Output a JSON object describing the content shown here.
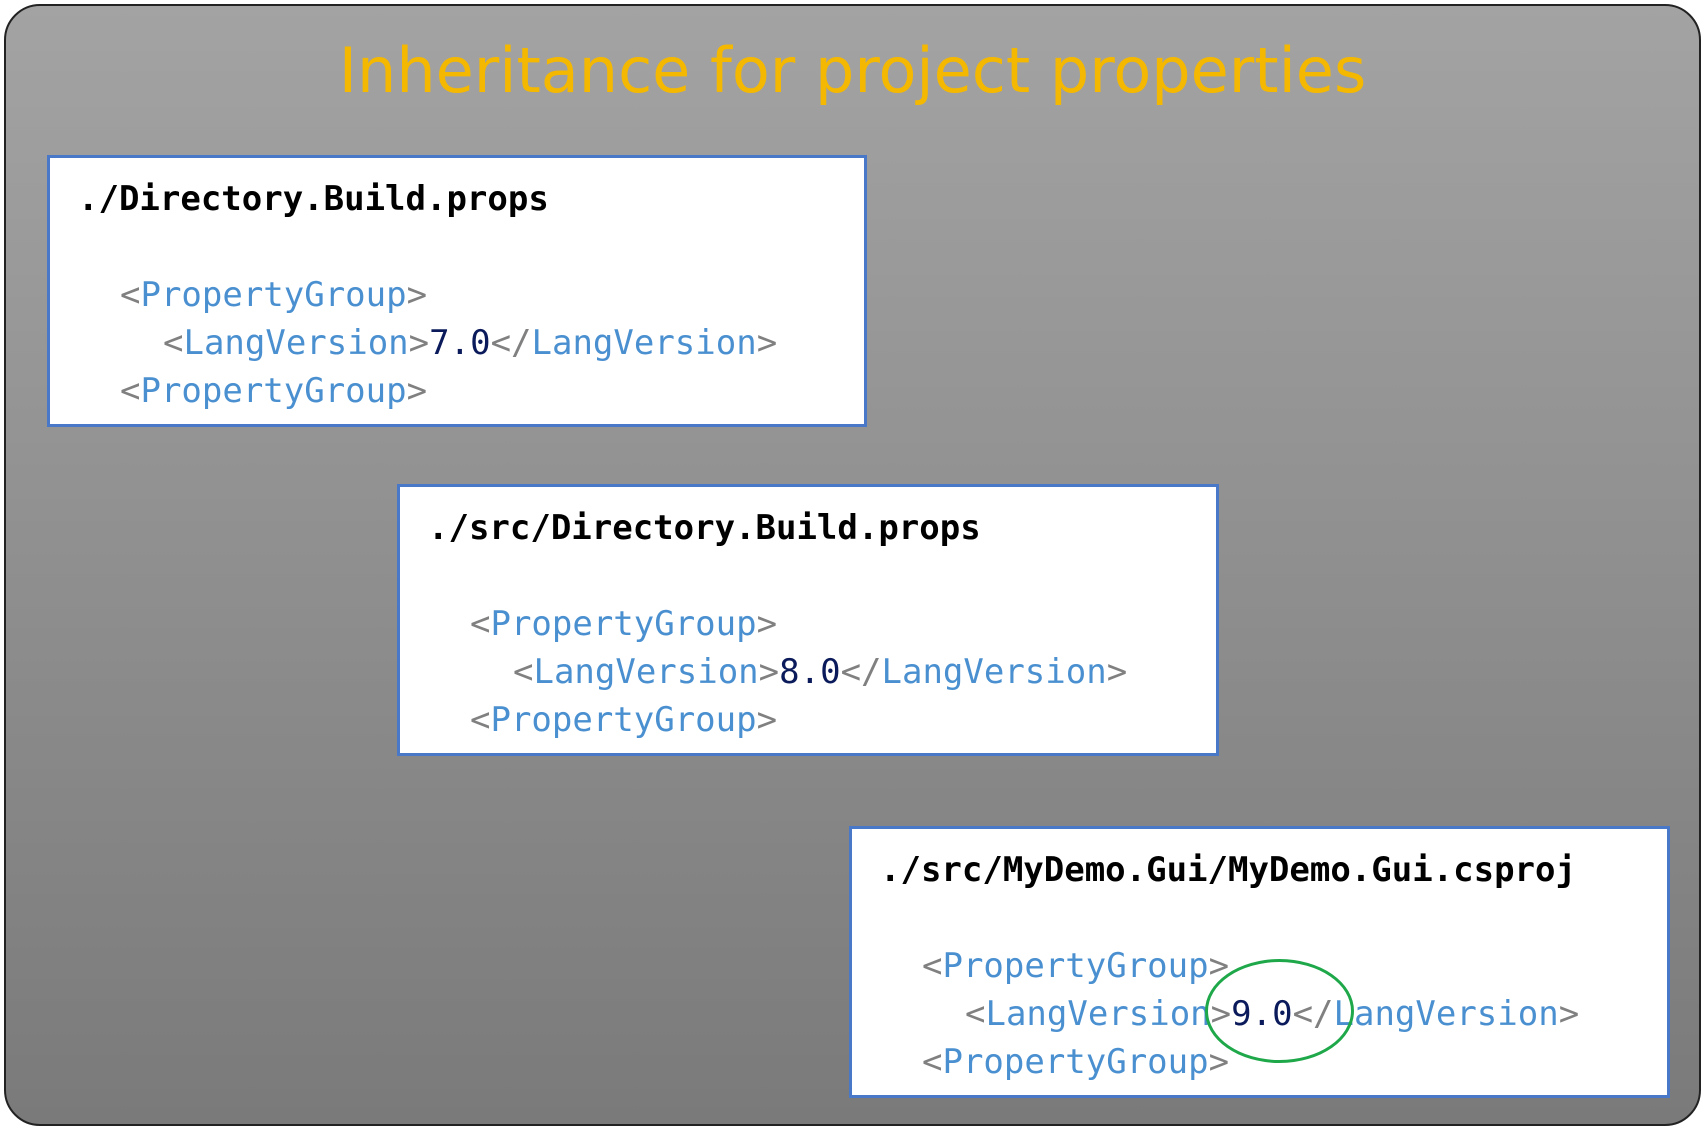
{
  "title": "Inheritance for project properties",
  "colors": {
    "title": "#f5b800",
    "box_border": "#4a78c8",
    "tag": "#4a90d0",
    "bracket": "#808080",
    "value": "#0a1a5a",
    "highlight": "#1fa84a"
  },
  "boxes": [
    {
      "path": "./Directory.Build.props",
      "open_group": "PropertyGroup",
      "element": "LangVersion",
      "value": "7.0",
      "close_group": "PropertyGroup"
    },
    {
      "path": "./src/Directory.Build.props",
      "open_group": "PropertyGroup",
      "element": "LangVersion",
      "value": "8.0",
      "close_group": "PropertyGroup"
    },
    {
      "path": "./src/MyDemo.Gui/MyDemo.Gui.csproj",
      "open_group": "PropertyGroup",
      "element": "LangVersion",
      "value": "9.0",
      "close_group": "PropertyGroup"
    }
  ],
  "highlighted_value": "9.0"
}
